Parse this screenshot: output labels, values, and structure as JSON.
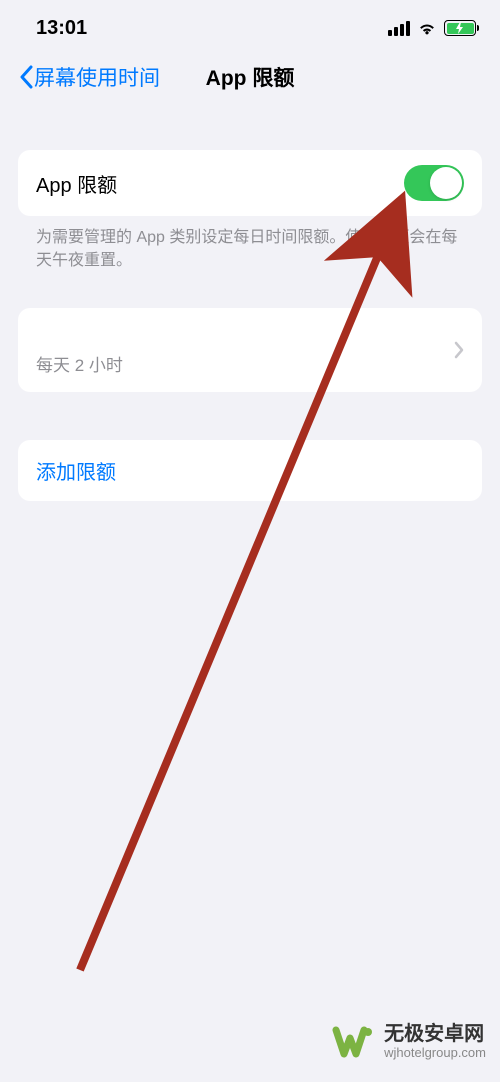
{
  "status": {
    "time": "13:01"
  },
  "nav": {
    "back_label": "屏幕使用时间",
    "title": "App 限额"
  },
  "toggleCell": {
    "title": "App 限额",
    "on": true
  },
  "footer": "为需要管理的 App 类别设定每日时间限额。使用限额会在每天午夜重置。",
  "limit": {
    "primary": " ",
    "secondary": "每天 2 小时"
  },
  "addLimit": "添加限额",
  "watermark": {
    "title": "无极安卓网",
    "url": "wjhotelgroup.com"
  }
}
